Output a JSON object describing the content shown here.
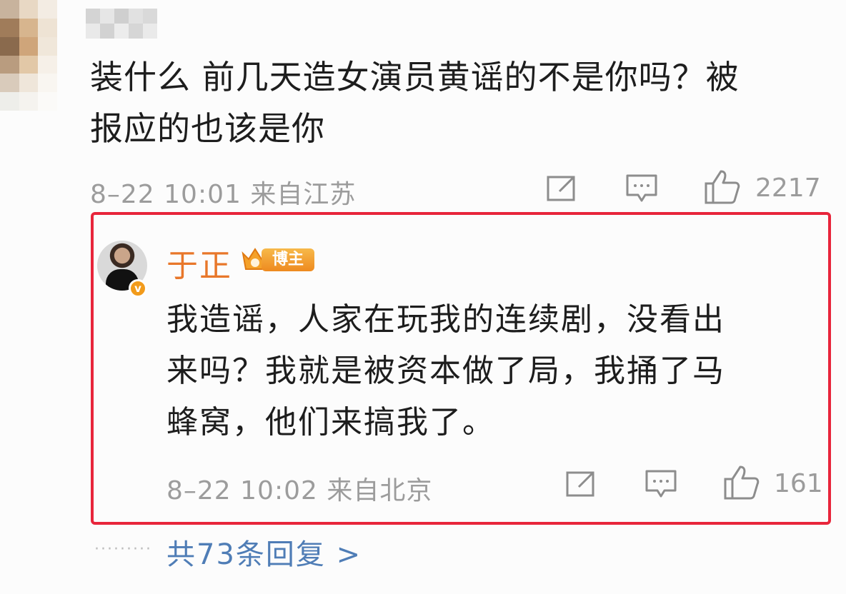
{
  "comment": {
    "text_line1": "装什么 前几天造女演员黄谣的不是你吗？被",
    "text_line2": "报应的也该是你",
    "meta": "8–22 10:01 来自江苏",
    "likes": "2217",
    "icons": [
      "share-icon",
      "comment-icon",
      "like-icon"
    ]
  },
  "reply": {
    "author": "于正",
    "badge_label": "博主",
    "verified_mark": "v",
    "text_line1": "我造谣，人家在玩我的连续剧，没看出",
    "text_line2": "来吗？我就是被资本做了局，我捅了马",
    "text_line3": "蜂窝，他们来搞我了。",
    "meta": "8–22 10:02 来自北京",
    "likes": "161",
    "icons": [
      "share-icon",
      "comment-icon",
      "like-icon"
    ]
  },
  "thread": {
    "dots": "·········",
    "more_replies": "共73条回复 >"
  },
  "colors": {
    "highlight_border": "#e8253b",
    "author_name": "#e8772a",
    "link": "#4f7db6",
    "meta_gray": "#9c9c9c"
  }
}
